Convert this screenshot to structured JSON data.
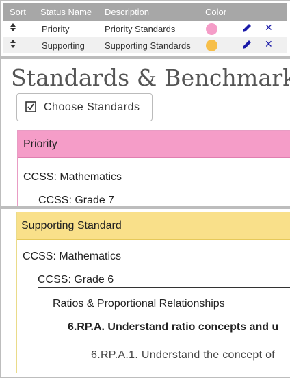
{
  "status_table": {
    "headers": {
      "sort": "Sort",
      "name": "Status Name",
      "description": "Description",
      "color": "Color"
    },
    "rows": [
      {
        "name": "Priority",
        "description": "Priority Standards",
        "color": "#f59dc8"
      },
      {
        "name": "Supporting",
        "description": "Supporting Standards",
        "color": "#f7bf4a"
      }
    ],
    "icon_color": "#1a1aa8"
  },
  "standards": {
    "title": "Standards & Benchmarks",
    "choose_button": "Choose Standards",
    "priority": {
      "header": "Priority",
      "header_color": "#f59dc8",
      "subject": "CCSS: Mathematics",
      "grade": "CCSS: Grade 7"
    }
  },
  "supporting": {
    "header": "Supporting Standard",
    "header_color": "#f9e08a",
    "subject": "CCSS: Mathematics",
    "grade": "CCSS: Grade 6",
    "domain": "Ratios & Proportional Relationships",
    "cluster": "6.RP.A. Understand ratio concepts and u",
    "standard": "6.RP.A.1. Understand the concept of"
  }
}
